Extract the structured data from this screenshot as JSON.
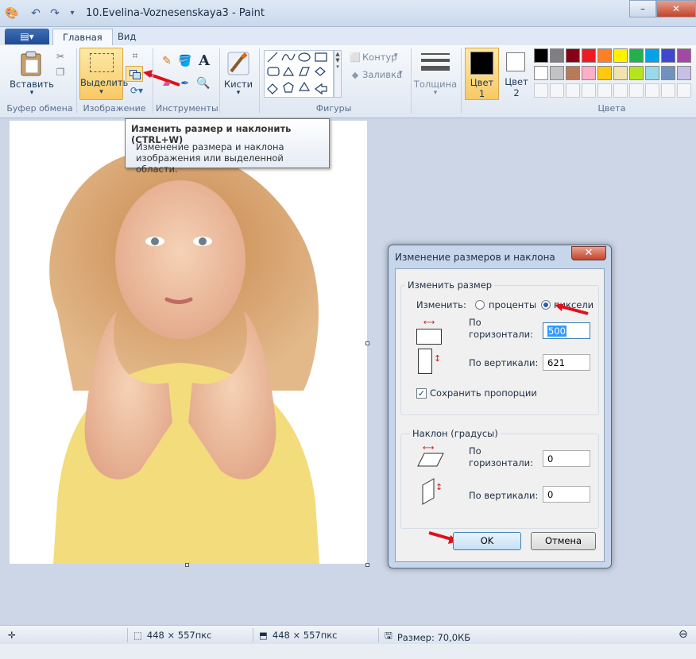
{
  "window": {
    "title": "10.Evelina-Voznesenskaya3 - Paint",
    "minimize_symbol": "–",
    "close_symbol": "✕"
  },
  "tabs": {
    "menu_symbol": "▤▾",
    "home": "Главная",
    "view": "Вид"
  },
  "ribbon": {
    "clipboard": {
      "paste": "Вставить",
      "group": "Буфер обмена"
    },
    "image": {
      "select": "Выделить",
      "group": "Изображение"
    },
    "tools": {
      "group": "Инструменты"
    },
    "brushes": {
      "label": "Кисти"
    },
    "shapes": {
      "outline": "Контур",
      "fill": "Заливка",
      "group": "Фигуры"
    },
    "size": {
      "label": "Толщина"
    },
    "color1": {
      "label": "Цвет",
      "num": "1",
      "value": "#000000"
    },
    "color2": {
      "label": "Цвет",
      "num": "2",
      "value": "#ffffff"
    },
    "colors": {
      "group": "Цвета",
      "row1": [
        "#000000",
        "#7f7f7f",
        "#880015",
        "#ed1c24",
        "#ff7f27",
        "#fff200",
        "#22b14c",
        "#00a2e8",
        "#3f48cc",
        "#a349a4"
      ],
      "row2": [
        "#ffffff",
        "#c3c3c3",
        "#b97a57",
        "#ffaec9",
        "#ffc90e",
        "#efe4b0",
        "#b5e61d",
        "#99d9ea",
        "#7092be",
        "#c8bfe7"
      ]
    }
  },
  "tooltip": {
    "title": "Изменить размер и наклонить (CTRL+W)",
    "description": "Изменение размера и наклона изображения или выделенной области."
  },
  "dialog": {
    "title": "Изменение размеров и наклона",
    "resize_legend": "Изменить размер",
    "by_label": "Изменить:",
    "percent_label": "проценты",
    "pixels_label": "пиксели",
    "horizontal_label": "По горизонтали:",
    "vertical_label": "По вертикали:",
    "resize_h_value": "500",
    "resize_v_value": "621",
    "keep_ratio_label": "Сохранить пропорции",
    "keep_ratio_checked": true,
    "skew_legend": "Наклон (градусы)",
    "skew_h_value": "0",
    "skew_v_value": "0",
    "ok_label": "OK",
    "cancel_label": "Отмена"
  },
  "statusbar": {
    "selection_size": "448 × 557пкс",
    "image_size": "448 × 557пкс",
    "file_size": "Размер: 70,0КБ"
  }
}
